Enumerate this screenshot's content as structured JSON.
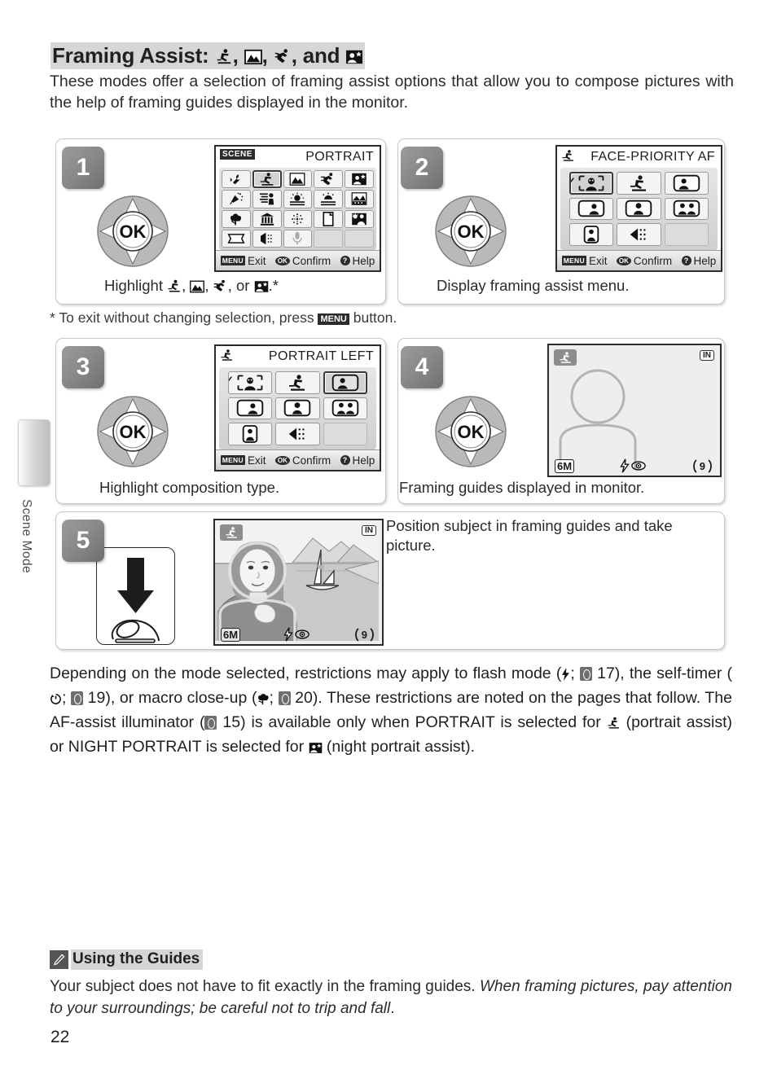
{
  "page": {
    "number": "22",
    "side_tab_label": "Scene Mode"
  },
  "heading": {
    "prefix": "Framing Assist:",
    "icons": [
      "portrait-assist-icon",
      "landscape-assist-icon",
      "sports-assist-icon",
      "night-portrait-assist-icon"
    ],
    "separator1": ",",
    "separator2": ",",
    "conjunction": ", and"
  },
  "intro": "These modes offer a selection of framing assist options that allow you to compose pictures with the help of framing guides displayed in the monitor.",
  "footnote": {
    "prefix": "* To exit without changing selection, press",
    "button": "MENU",
    "suffix": "button."
  },
  "steps": [
    {
      "number": "1",
      "caption_prefix": "Highlight",
      "caption_suffix": ".*",
      "screen": {
        "mode_chip": "SCENE",
        "title": "PORTRAIT",
        "selected_index": 1,
        "cells": [
          "setup-icon",
          "portrait-assist-icon",
          "landscape-assist-icon",
          "sports-assist-icon",
          "night-portrait-assist-icon",
          "party-indoor-icon",
          "beach-snow-icon",
          "sunset-icon",
          "dusk-dawn-icon",
          "night-landscape-icon",
          "close-up-icon",
          "museum-icon",
          "fireworks-icon",
          "copy-icon",
          "back-light-icon",
          "panorama-assist-icon",
          "voice-recording-icon",
          "microphone-icon",
          "",
          ""
        ],
        "footer": {
          "exit": "Exit",
          "confirm": "Confirm",
          "help": "Help",
          "menu_key": "MENU",
          "ok_key": "OK",
          "help_key": "?"
        }
      }
    },
    {
      "number": "2",
      "caption": "Display framing assist menu.",
      "screen": {
        "mode_chip": "portrait-assist-icon",
        "title": "FACE-PRIORITY AF",
        "selected_index": 0,
        "checked_index": 0,
        "cells": [
          "face-priority-af-icon",
          "portrait-assist-icon",
          "portrait-left-icon",
          "portrait-right-icon",
          "portrait-close-up-icon",
          "portrait-couple-icon",
          "portrait-figure-icon",
          "panorama-left-icon",
          ""
        ],
        "footer": {
          "exit": "Exit",
          "confirm": "Confirm",
          "help": "Help",
          "menu_key": "MENU",
          "ok_key": "OK",
          "help_key": "?"
        }
      }
    },
    {
      "number": "3",
      "caption": "Highlight composition type.",
      "screen": {
        "mode_chip": "portrait-assist-icon",
        "title": "PORTRAIT LEFT",
        "selected_index": 2,
        "checked_index": 0,
        "cells": [
          "face-priority-af-icon",
          "portrait-assist-icon",
          "portrait-left-icon",
          "portrait-right-icon",
          "portrait-close-up-icon",
          "portrait-couple-icon",
          "portrait-figure-icon",
          "panorama-left-icon",
          ""
        ],
        "footer": {
          "exit": "Exit",
          "confirm": "Confirm",
          "help": "Help",
          "menu_key": "MENU",
          "ok_key": "OK",
          "help_key": "?"
        }
      }
    },
    {
      "number": "4",
      "caption": "Framing guides displayed in monitor.",
      "screen": {
        "mode_chip": "portrait-assist-icon",
        "memory_badge": "IN",
        "image_size": "6M",
        "flash_mode": "red-eye-reduction-icon",
        "shots_remaining": "9"
      }
    },
    {
      "number": "5",
      "caption": "Position subject in framing guides and take picture.",
      "screen": {
        "mode_chip": "portrait-assist-icon",
        "memory_badge": "IN",
        "image_size": "6M",
        "flash_mode": "red-eye-reduction-icon",
        "shots_remaining": "9"
      }
    }
  ],
  "body_text": {
    "l1": "Depending on the mode selected, restrictions may apply to flash mode (",
    "l1b": "; ",
    "l1c": " 17), the self-timer (",
    "l1d": "; ",
    "l1e": " 19), or macro close-up (",
    "l1f": "; ",
    "l1g": " 20).  These restrictions are noted on the pages that follow.  The AF-assist illuminator (",
    "l1h": " 15) is available only when PORTRAIT is selected for ",
    "l1i": " (portrait assist) or NIGHT PORTRAIT is selected for ",
    "l1j": " (night portrait assist)."
  },
  "note": {
    "title": "Using the Guides",
    "icon": "pencil-icon",
    "text_plain": "Your subject does not have to fit exactly in the framing guides.  ",
    "text_italic": "When framing pictures, pay attention to your surroundings; be careful not to trip and fall",
    "text_end": "."
  }
}
